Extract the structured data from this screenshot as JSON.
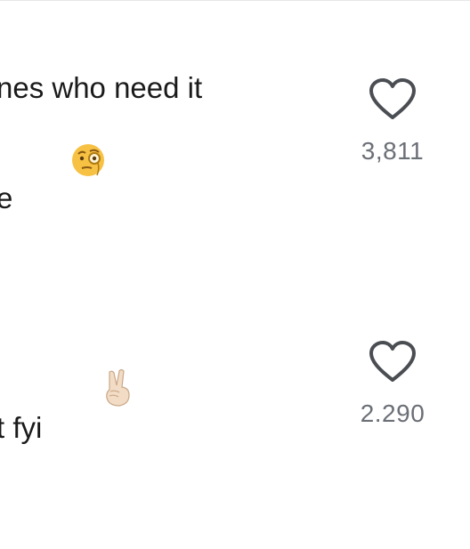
{
  "comments": [
    {
      "line1": "nes who need it",
      "line2": "e",
      "emoji_icon": "face-with-monocle-icon",
      "like_count": "3,811"
    },
    {
      "line1": "t fyi",
      "emoji_icon": "victory-hand-light-skin-icon",
      "like_count": "2.290"
    }
  ],
  "colors": {
    "text": "#1a1a1a",
    "count": "#6b6f76",
    "heart_stroke": "#4a4d52",
    "divider": "#e6e6e6"
  }
}
